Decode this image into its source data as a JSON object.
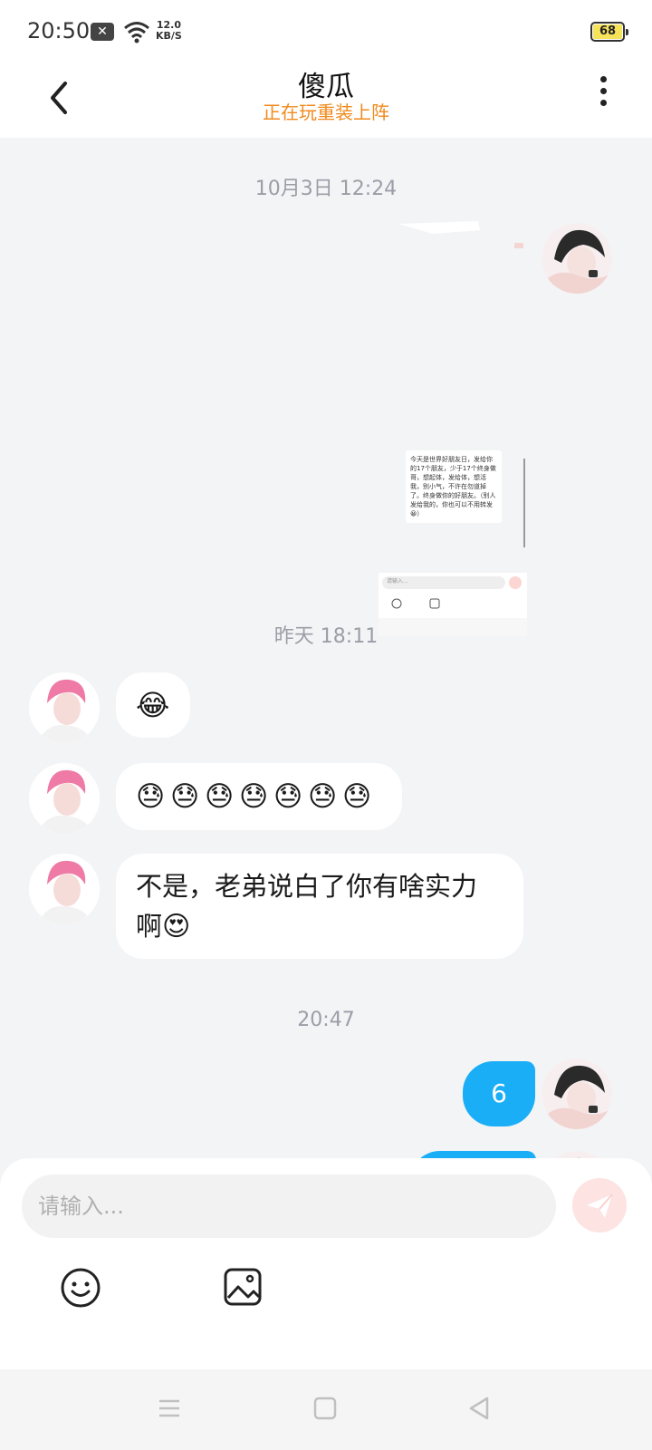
{
  "status_bar": {
    "time": "20:50",
    "net_speed_value": "12.0",
    "net_speed_unit": "KB/S",
    "battery": "68"
  },
  "header": {
    "title": "傻瓜",
    "subtitle": "正在玩重装上阵"
  },
  "chat": {
    "timestamps": [
      "10月3日 12:24",
      "昨天 18:11",
      "20:47"
    ],
    "image_message": {
      "note_text": "今天是世界好朋友日，发给你的17个朋友，少于17个终身做哥，想起体，发给体，想活我，别小气，不许在勿道掉了。终身做你的好朋友。（别人发给我的，你也可以不用转发😀）",
      "input_placeholder": "请输入..."
    },
    "incoming_messages": [
      {
        "emojis": [
          "😂"
        ]
      },
      {
        "emojis": [
          "😓",
          "😓",
          "😓",
          "😓",
          "😓",
          "😓",
          "😓"
        ]
      },
      {
        "text_line1": "不是，老弟说白了你有啥实力",
        "text_line2": "啊",
        "emoji": "😍"
      }
    ],
    "outgoing_messages": [
      {
        "text": "6"
      }
    ]
  },
  "input": {
    "placeholder": "请输入..."
  },
  "icons": {
    "back": "chevron-left-icon",
    "more": "more-vertical-icon",
    "send": "send-icon",
    "emoji": "smile-icon",
    "image": "image-icon",
    "nav_menu": "menu-icon",
    "nav_home": "square-icon",
    "nav_back": "triangle-back-icon"
  },
  "colors": {
    "accent_blue": "#1aaef7",
    "subtitle_orange": "#f08a1c",
    "send_disabled": "#fde3e1"
  }
}
